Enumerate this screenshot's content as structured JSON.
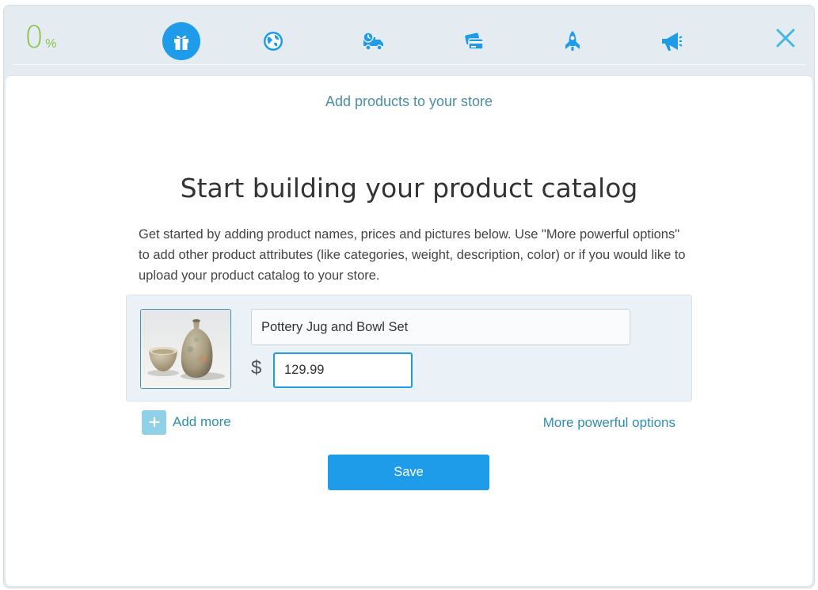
{
  "progress": {
    "value": "0",
    "unit": "%"
  },
  "steps": [
    {
      "name": "gift-icon",
      "active": true
    },
    {
      "name": "globe-icon",
      "active": false
    },
    {
      "name": "delivery-truck-icon",
      "active": false
    },
    {
      "name": "credit-card-icon",
      "active": false
    },
    {
      "name": "rocket-icon",
      "active": false
    },
    {
      "name": "megaphone-icon",
      "active": false
    }
  ],
  "colors": {
    "accent": "#1e9be9",
    "progress": "#8bc34a",
    "link": "#2d8fb0"
  },
  "panel": {
    "subtitle": "Add products to your store",
    "heading": "Start building your product catalog",
    "description": "Get started by adding product names, prices and pictures below. Use \"More powerful options\" to add other product attributes (like categories, weight, description, color) or if you would like to upload your product catalog to your store."
  },
  "product": {
    "name_value": "Pottery Jug and Bowl Set",
    "currency": "$",
    "price_value": "129.99"
  },
  "actions": {
    "add_more": "Add more",
    "more_options": "More powerful options",
    "save": "Save"
  }
}
